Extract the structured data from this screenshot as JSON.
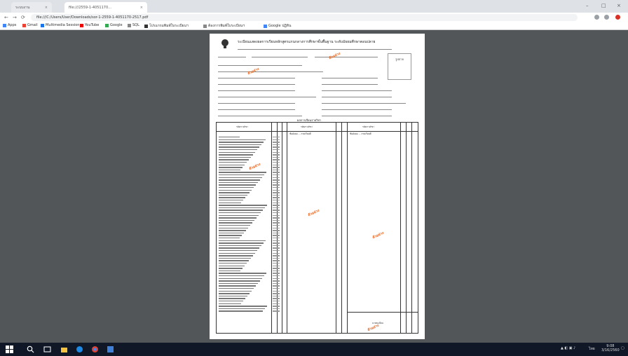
{
  "browser": {
    "tabs": [
      {
        "label": "ระบบงาน"
      },
      {
        "label": "file:///2559-1-4051170..."
      }
    ],
    "url": "file:///C:/Users/User/Downloads/sor-1-2559-1-4051170-2517.pdf",
    "bookmarks": [
      "Apps",
      "Gmail",
      "Multimedia Session",
      "YouTube",
      "Google",
      "SQL",
      "โปรแกรมพิมพ์ใบระเบียนฯ",
      "ต้องการพิมพ์ใบระเบียนฯ",
      "Google ปฏิทิน"
    ]
  },
  "document": {
    "header_title": "ระเบียนแสดงผลการเรียนหลักสูตรแกนกลางการศึกษาขั้นพื้นฐาน ระดับมัธยมศึกษาตอนปลาย",
    "stamps": [
      "ตัวอย่าง",
      "ตัวอย่าง",
      "ตัวอย่าง",
      "ตัวอย่าง",
      "ตัวอย่าง",
      "ตัวอย่าง"
    ],
    "photo_label": "รูปถ่าย",
    "section_title": "ผลการเรียนรายวิชา",
    "table_headers": [
      "รหัส/รายวิชา",
      "หน่วยกิต",
      "ผลการเรียน"
    ],
    "col2_title": "ชั้นมัธยม ... ภาคเรียนที่",
    "col3_title": "ชั้นมัธยม ... ภาคเรียนที่",
    "signature": "นายทะเบียน"
  },
  "taskbar": {
    "time": "9:08",
    "date": "3/16/2560",
    "lang": "ไทย"
  }
}
